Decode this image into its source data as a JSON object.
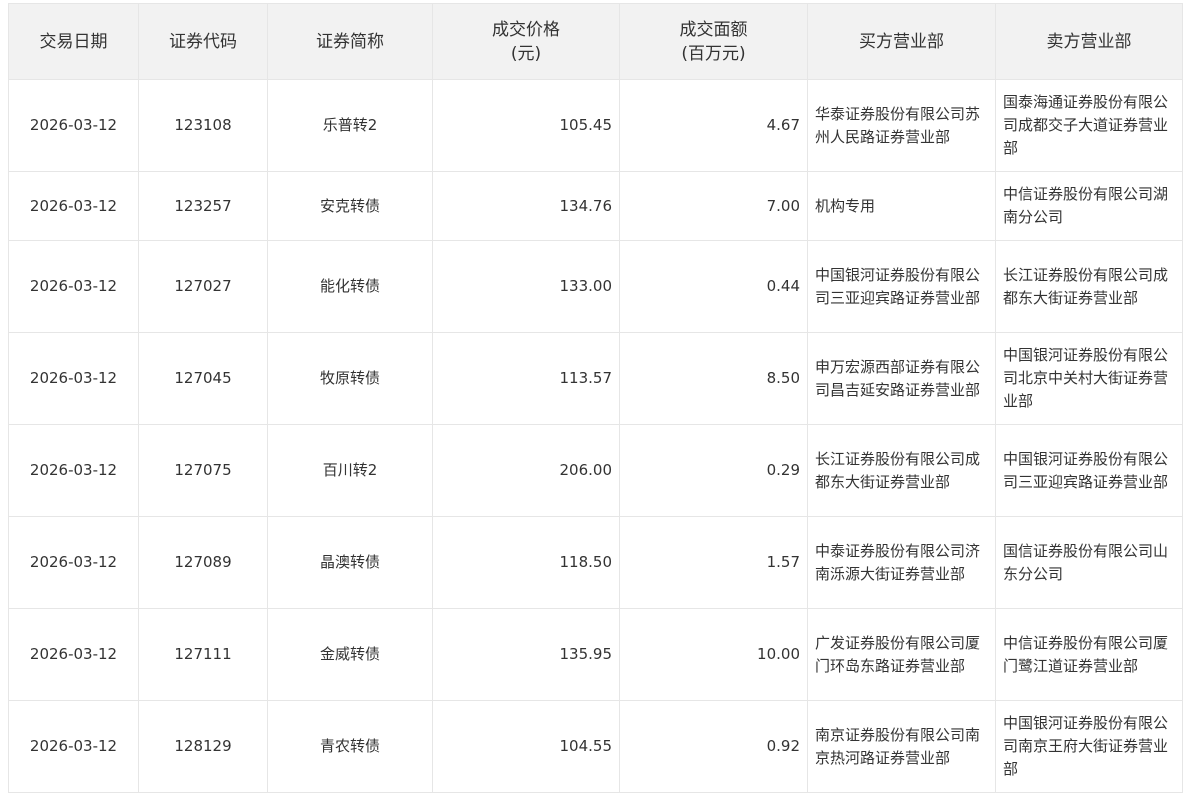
{
  "table": {
    "headers": [
      {
        "text": "交易日期"
      },
      {
        "text": "证券代码"
      },
      {
        "text": "证券简称"
      },
      {
        "text": "成交价格",
        "sub": "(元)"
      },
      {
        "text": "成交面额",
        "sub": "(百万元)"
      },
      {
        "text": "买方营业部"
      },
      {
        "text": "卖方营业部"
      }
    ],
    "rows": [
      [
        "2026-03-12",
        "123108",
        "乐普转2",
        "105.45",
        "4.67",
        "华泰证券股份有限公司苏州人民路证券营业部",
        "国泰海通证券股份有限公司成都交子大道证券营业部"
      ],
      [
        "2026-03-12",
        "123257",
        "安克转债",
        "134.76",
        "7.00",
        "机构专用",
        "中信证券股份有限公司湖南分公司"
      ],
      [
        "2026-03-12",
        "127027",
        "能化转债",
        "133.00",
        "0.44",
        "中国银河证券股份有限公司三亚迎宾路证券营业部",
        "长江证券股份有限公司成都东大街证券营业部"
      ],
      [
        "2026-03-12",
        "127045",
        "牧原转债",
        "113.57",
        "8.50",
        "申万宏源西部证券有限公司昌吉延安路证券营业部",
        "中国银河证券股份有限公司北京中关村大街证券营业部"
      ],
      [
        "2026-03-12",
        "127075",
        "百川转2",
        "206.00",
        "0.29",
        "长江证券股份有限公司成都东大街证券营业部",
        "中国银河证券股份有限公司三亚迎宾路证券营业部"
      ],
      [
        "2026-03-12",
        "127089",
        "晶澳转债",
        "118.50",
        "1.57",
        "中泰证券股份有限公司济南泺源大街证券营业部",
        "国信证券股份有限公司山东分公司"
      ],
      [
        "2026-03-12",
        "127111",
        "金威转债",
        "135.95",
        "10.00",
        "广发证券股份有限公司厦门环岛东路证券营业部",
        "中信证券股份有限公司厦门鹭江道证券营业部"
      ],
      [
        "2026-03-12",
        "128129",
        "青农转债",
        "104.55",
        "0.92",
        "南京证券股份有限公司南京热河路证券营业部",
        "中国银河证券股份有限公司南京王府大街证券营业部"
      ]
    ]
  }
}
